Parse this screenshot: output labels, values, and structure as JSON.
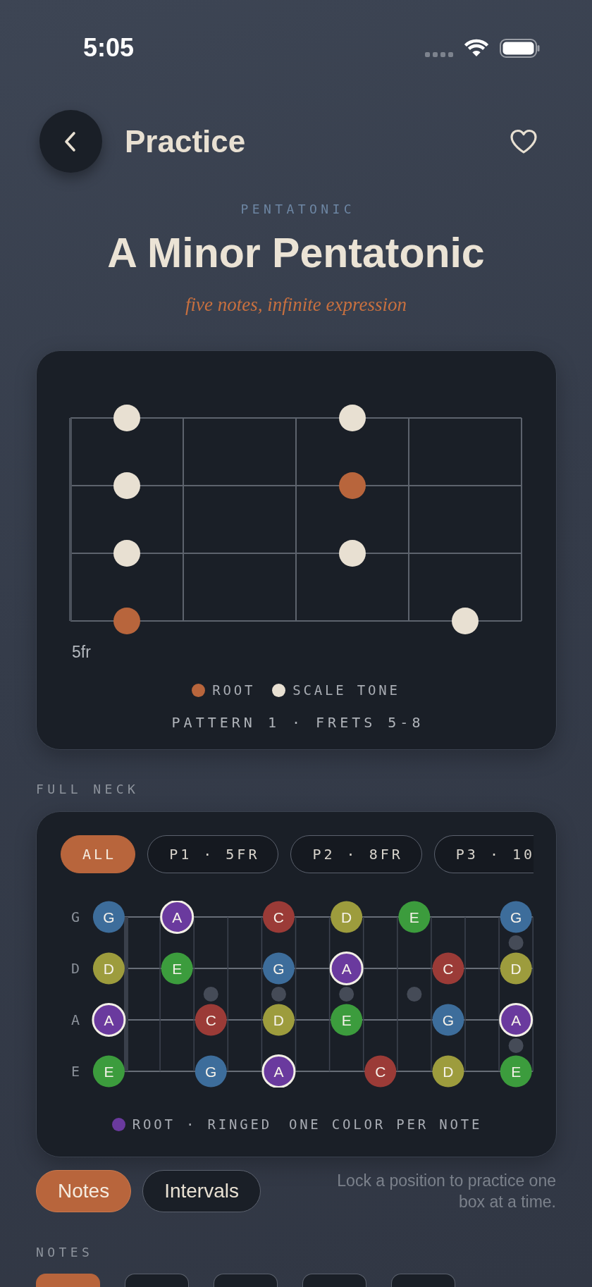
{
  "status_bar": {
    "time": "5:05"
  },
  "header": {
    "title": "Practice",
    "favorite": false
  },
  "hero": {
    "eyebrow": "PENTATONIC",
    "title": "A Minor Pentatonic",
    "tagline": "five notes, infinite expression"
  },
  "pattern": {
    "strings": [
      {
        "frets": [
          {
            "kind": "scale"
          },
          {
            "kind": "empty"
          },
          {
            "kind": "scale"
          },
          {
            "kind": "empty"
          }
        ]
      },
      {
        "frets": [
          {
            "kind": "scale"
          },
          {
            "kind": "empty"
          },
          {
            "kind": "root"
          },
          {
            "kind": "empty"
          }
        ]
      },
      {
        "frets": [
          {
            "kind": "scale"
          },
          {
            "kind": "empty"
          },
          {
            "kind": "scale"
          },
          {
            "kind": "empty"
          }
        ]
      },
      {
        "frets": [
          {
            "kind": "root"
          },
          {
            "kind": "empty"
          },
          {
            "kind": "empty"
          },
          {
            "kind": "scale"
          }
        ]
      }
    ],
    "start_fret": "5fr",
    "legend": [
      {
        "kind": "root",
        "label": "ROOT"
      },
      {
        "kind": "scale",
        "label": "SCALE TONE"
      }
    ],
    "caption": "PATTERN 1 · FRETS 5-8"
  },
  "full_neck": {
    "label": "FULL NECK",
    "chips": [
      {
        "label": "ALL",
        "selected": true
      },
      {
        "label": "P1 · 5FR",
        "selected": false
      },
      {
        "label": "P2 · 8FR",
        "selected": false
      },
      {
        "label": "P3 · 10",
        "selected": false
      }
    ],
    "inlays": [
      {
        "kind": "none"
      },
      {
        "kind": "none"
      },
      {
        "kind": "none"
      },
      {
        "kind": "single"
      },
      {
        "kind": "none"
      },
      {
        "kind": "single"
      },
      {
        "kind": "none"
      },
      {
        "kind": "single"
      },
      {
        "kind": "none"
      },
      {
        "kind": "single"
      },
      {
        "kind": "none"
      },
      {
        "kind": "none"
      },
      {
        "kind": "double"
      }
    ],
    "strings": [
      {
        "label": "G",
        "cells": [
          {
            "kind": "note",
            "note": "G",
            "color": "#3d6d9b",
            "root": false
          },
          {
            "kind": "empty"
          },
          {
            "kind": "note",
            "note": "A",
            "color": "#6a3a9e",
            "root": true
          },
          {
            "kind": "empty"
          },
          {
            "kind": "empty"
          },
          {
            "kind": "note",
            "note": "C",
            "color": "#9b3b37",
            "root": false
          },
          {
            "kind": "empty"
          },
          {
            "kind": "note",
            "note": "D",
            "color": "#9d9c3d",
            "root": false
          },
          {
            "kind": "empty"
          },
          {
            "kind": "note",
            "note": "E",
            "color": "#3c9c3d",
            "root": false
          },
          {
            "kind": "empty"
          },
          {
            "kind": "empty"
          },
          {
            "kind": "note",
            "note": "G",
            "color": "#3d6d9b",
            "root": false
          }
        ]
      },
      {
        "label": "D",
        "cells": [
          {
            "kind": "note",
            "note": "D",
            "color": "#9d9c3d",
            "root": false
          },
          {
            "kind": "empty"
          },
          {
            "kind": "note",
            "note": "E",
            "color": "#3c9c3d",
            "root": false
          },
          {
            "kind": "empty"
          },
          {
            "kind": "empty"
          },
          {
            "kind": "note",
            "note": "G",
            "color": "#3d6d9b",
            "root": false
          },
          {
            "kind": "empty"
          },
          {
            "kind": "note",
            "note": "A",
            "color": "#6a3a9e",
            "root": true
          },
          {
            "kind": "empty"
          },
          {
            "kind": "empty"
          },
          {
            "kind": "note",
            "note": "C",
            "color": "#9b3b37",
            "root": false
          },
          {
            "kind": "empty"
          },
          {
            "kind": "note",
            "note": "D",
            "color": "#9d9c3d",
            "root": false
          }
        ]
      },
      {
        "label": "A",
        "cells": [
          {
            "kind": "note",
            "note": "A",
            "color": "#6a3a9e",
            "root": true
          },
          {
            "kind": "empty"
          },
          {
            "kind": "empty"
          },
          {
            "kind": "note",
            "note": "C",
            "color": "#9b3b37",
            "root": false
          },
          {
            "kind": "empty"
          },
          {
            "kind": "note",
            "note": "D",
            "color": "#9d9c3d",
            "root": false
          },
          {
            "kind": "empty"
          },
          {
            "kind": "note",
            "note": "E",
            "color": "#3c9c3d",
            "root": false
          },
          {
            "kind": "empty"
          },
          {
            "kind": "empty"
          },
          {
            "kind": "note",
            "note": "G",
            "color": "#3d6d9b",
            "root": false
          },
          {
            "kind": "empty"
          },
          {
            "kind": "note",
            "note": "A",
            "color": "#6a3a9e",
            "root": true
          }
        ]
      },
      {
        "label": "E",
        "cells": [
          {
            "kind": "note",
            "note": "E",
            "color": "#3c9c3d",
            "root": false
          },
          {
            "kind": "empty"
          },
          {
            "kind": "empty"
          },
          {
            "kind": "note",
            "note": "G",
            "color": "#3d6d9b",
            "root": false
          },
          {
            "kind": "empty"
          },
          {
            "kind": "note",
            "note": "A",
            "color": "#6a3a9e",
            "root": true
          },
          {
            "kind": "empty"
          },
          {
            "kind": "empty"
          },
          {
            "kind": "note",
            "note": "C",
            "color": "#9b3b37",
            "root": false
          },
          {
            "kind": "empty"
          },
          {
            "kind": "note",
            "note": "D",
            "color": "#9d9c3d",
            "root": false
          },
          {
            "kind": "empty"
          },
          {
            "kind": "note",
            "note": "E",
            "color": "#3c9c3d",
            "root": false
          }
        ]
      }
    ],
    "legend": {
      "color": "#6a3a9e",
      "items": [
        "ROOT · RINGED",
        "ONE COLOR PER NOTE"
      ]
    }
  },
  "view_toggle": {
    "options": [
      {
        "label": "Notes",
        "selected": true
      },
      {
        "label": "Intervals",
        "selected": false
      }
    ],
    "hint": "Lock a position to practice one box at a time."
  },
  "notes": {
    "label": "NOTES",
    "tiles": [
      {
        "selected": true
      },
      {
        "selected": false
      },
      {
        "selected": false
      },
      {
        "selected": false
      },
      {
        "selected": false
      }
    ]
  }
}
